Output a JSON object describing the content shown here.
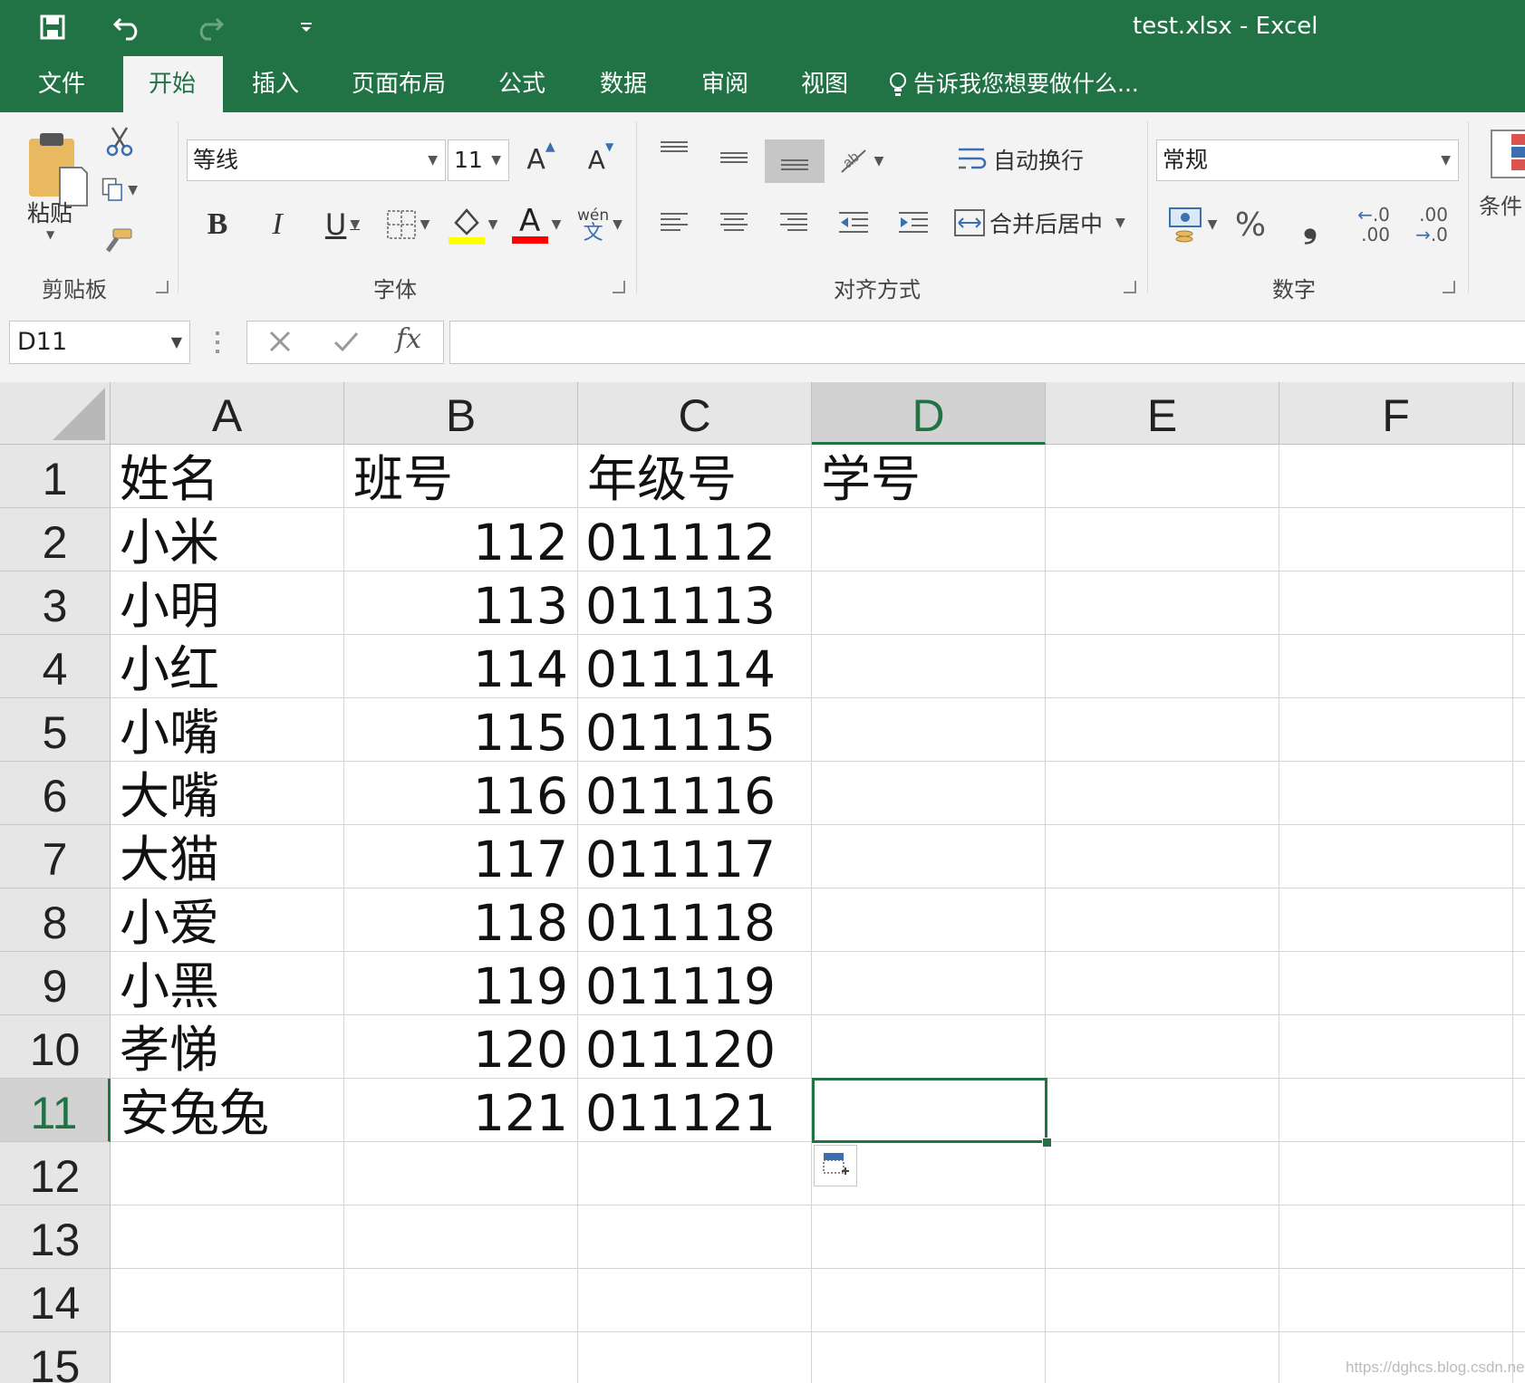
{
  "window": {
    "title": "test.xlsx - Excel"
  },
  "tabs": [
    "文件",
    "开始",
    "插入",
    "页面布局",
    "公式",
    "数据",
    "审阅",
    "视图"
  ],
  "active_tab": "开始",
  "tell_me": "告诉我您想要做什么...",
  "ribbon": {
    "clipboard": {
      "paste_label": "粘贴",
      "group_label": "剪贴板"
    },
    "font": {
      "font_name": "等线",
      "font_size": "11",
      "group_label": "字体",
      "phonetic_top": "wén",
      "phonetic_bottom": "文",
      "fill_color": "#ffff00",
      "font_color": "#ff0000"
    },
    "alignment": {
      "wrap_label": "自动换行",
      "merge_label": "合并后居中",
      "group_label": "对齐方式"
    },
    "number": {
      "format": "常规",
      "percent": "%",
      "comma": "❟",
      "inc_decimal_top": ".0",
      "inc_decimal_bottom": ".00",
      "dec_decimal_top": ".00",
      "dec_decimal_bottom": ".0",
      "group_label": "数字"
    },
    "styles": {
      "cond_format_partial": "条件"
    }
  },
  "formula_bar": {
    "name_box": "D11",
    "fx": "fx",
    "content": ""
  },
  "columns": [
    "A",
    "B",
    "C",
    "D",
    "E",
    "F"
  ],
  "selected_column": "D",
  "selected_row": "11",
  "rows": [
    {
      "n": "1",
      "A": "姓名",
      "B": "班号",
      "C": "年级号",
      "D": "学号"
    },
    {
      "n": "2",
      "A": "小米",
      "B": "112",
      "C": "011112",
      "D": ""
    },
    {
      "n": "3",
      "A": "小明",
      "B": "113",
      "C": "011113",
      "D": ""
    },
    {
      "n": "4",
      "A": "小红",
      "B": "114",
      "C": "011114",
      "D": ""
    },
    {
      "n": "5",
      "A": "小嘴",
      "B": "115",
      "C": "011115",
      "D": ""
    },
    {
      "n": "6",
      "A": "大嘴",
      "B": "116",
      "C": "011116",
      "D": ""
    },
    {
      "n": "7",
      "A": "大猫",
      "B": "117",
      "C": "011117",
      "D": ""
    },
    {
      "n": "8",
      "A": "小爱",
      "B": "118",
      "C": "011118",
      "D": ""
    },
    {
      "n": "9",
      "A": "小黑",
      "B": "119",
      "C": "011119",
      "D": ""
    },
    {
      "n": "10",
      "A": "孝悌",
      "B": "120",
      "C": "011120",
      "D": ""
    },
    {
      "n": "11",
      "A": "安兔兔",
      "B": "121",
      "C": "011121",
      "D": ""
    },
    {
      "n": "12",
      "A": "",
      "B": "",
      "C": "",
      "D": ""
    },
    {
      "n": "13",
      "A": "",
      "B": "",
      "C": "",
      "D": ""
    },
    {
      "n": "14",
      "A": "",
      "B": "",
      "C": "",
      "D": ""
    },
    {
      "n": "15",
      "A": "",
      "B": "",
      "C": "",
      "D": ""
    }
  ],
  "watermark": "https://dghcs.blog.csdn.net",
  "colors": {
    "accent": "#217346",
    "header_bg": "#e6e6e6",
    "ribbon_bg": "#f3f3f3"
  }
}
